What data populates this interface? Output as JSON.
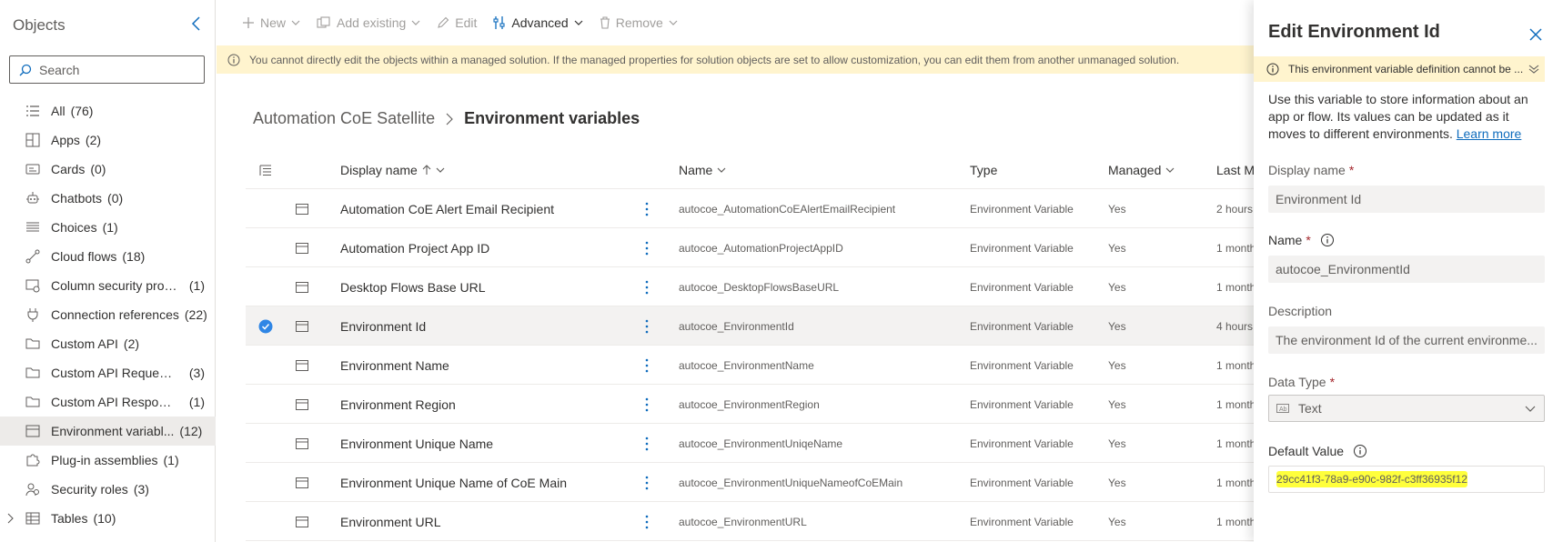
{
  "objects_pane": {
    "title": "Objects",
    "search_placeholder": "Search",
    "items": [
      {
        "label": "All",
        "count": "(76)",
        "icon": "list-icon",
        "selected": false
      },
      {
        "label": "Apps",
        "count": "(2)",
        "icon": "apps-icon",
        "selected": false
      },
      {
        "label": "Cards",
        "count": "(0)",
        "icon": "card-icon",
        "selected": false
      },
      {
        "label": "Chatbots",
        "count": "(0)",
        "icon": "bot-icon",
        "selected": false
      },
      {
        "label": "Choices",
        "count": "(1)",
        "icon": "choices-icon",
        "selected": false
      },
      {
        "label": "Cloud flows",
        "count": "(18)",
        "icon": "flow-icon",
        "selected": false
      },
      {
        "label": "Column security profi...",
        "count": "(1)",
        "icon": "security-profile-icon",
        "selected": false
      },
      {
        "label": "Connection references",
        "count": "(22)",
        "icon": "plug-icon",
        "selected": false
      },
      {
        "label": "Custom API",
        "count": "(2)",
        "icon": "folder-icon",
        "selected": false
      },
      {
        "label": "Custom API Request ...",
        "count": "(3)",
        "icon": "folder-icon",
        "selected": false
      },
      {
        "label": "Custom API Response...",
        "count": "(1)",
        "icon": "folder-icon",
        "selected": false
      },
      {
        "label": "Environment variabl...",
        "count": "(12)",
        "icon": "variable-icon",
        "selected": true
      },
      {
        "label": "Plug-in assemblies",
        "count": "(1)",
        "icon": "plugin-icon",
        "selected": false
      },
      {
        "label": "Security roles",
        "count": "(3)",
        "icon": "people-icon",
        "selected": false
      },
      {
        "label": "Tables",
        "count": "(10)",
        "icon": "table-icon",
        "selected": false
      }
    ]
  },
  "command_bar": {
    "new": "New",
    "add_existing": "Add existing",
    "edit": "Edit",
    "advanced": "Advanced",
    "remove": "Remove"
  },
  "notice": "You cannot directly edit the objects within a managed solution. If the managed properties for solution objects are set to allow customization, you can edit them from another unmanaged solution.",
  "breadcrumb": {
    "parent": "Automation CoE Satellite",
    "current": "Environment variables"
  },
  "grid": {
    "columns": {
      "display_name": "Display name",
      "name": "Name",
      "type": "Type",
      "managed": "Managed",
      "last_modified": "Last M"
    },
    "rows": [
      {
        "display": "Automation CoE Alert Email Recipient",
        "name": "autocoe_AutomationCoEAlertEmailRecipient",
        "type": "Environment Variable",
        "managed": "Yes",
        "last": "2 hours",
        "selected": false
      },
      {
        "display": "Automation Project App ID",
        "name": "autocoe_AutomationProjectAppID",
        "type": "Environment Variable",
        "managed": "Yes",
        "last": "1 month",
        "selected": false
      },
      {
        "display": "Desktop Flows Base URL",
        "name": "autocoe_DesktopFlowsBaseURL",
        "type": "Environment Variable",
        "managed": "Yes",
        "last": "1 month",
        "selected": false
      },
      {
        "display": "Environment Id",
        "name": "autocoe_EnvironmentId",
        "type": "Environment Variable",
        "managed": "Yes",
        "last": "4 hours",
        "selected": true
      },
      {
        "display": "Environment Name",
        "name": "autocoe_EnvironmentName",
        "type": "Environment Variable",
        "managed": "Yes",
        "last": "1 month",
        "selected": false
      },
      {
        "display": "Environment Region",
        "name": "autocoe_EnvironmentRegion",
        "type": "Environment Variable",
        "managed": "Yes",
        "last": "1 month",
        "selected": false
      },
      {
        "display": "Environment Unique Name",
        "name": "autocoe_EnvironmentUniqeName",
        "type": "Environment Variable",
        "managed": "Yes",
        "last": "1 month",
        "selected": false
      },
      {
        "display": "Environment Unique Name of CoE Main",
        "name": "autocoe_EnvironmentUniqueNameofCoEMain",
        "type": "Environment Variable",
        "managed": "Yes",
        "last": "1 month",
        "selected": false
      },
      {
        "display": "Environment URL",
        "name": "autocoe_EnvironmentURL",
        "type": "Environment Variable",
        "managed": "Yes",
        "last": "1 month",
        "selected": false
      }
    ]
  },
  "edit_panel": {
    "title": "Edit Environment Id",
    "warning": "This environment variable definition cannot be ...",
    "description": "Use this variable to store information about an app or flow. Its values can be updated as it moves to different environments.",
    "learn_more": "Learn more",
    "display_name_label": "Display name",
    "display_name_value": "Environment Id",
    "name_label": "Name",
    "name_value": "autocoe_EnvironmentId",
    "description_label": "Description",
    "description_value": "The environment Id of the current environme...",
    "data_type_label": "Data Type",
    "data_type_value": "Text",
    "default_value_label": "Default Value",
    "default_value": "29cc41f3-78a9-e90c-982f-c3ff36935f12",
    "required_mark": "*"
  },
  "colors": {
    "accent": "#0f6cbd",
    "warning_bg": "#fff4ce",
    "highlight": "#ffff3c",
    "selected_check": "#2f86e5"
  }
}
